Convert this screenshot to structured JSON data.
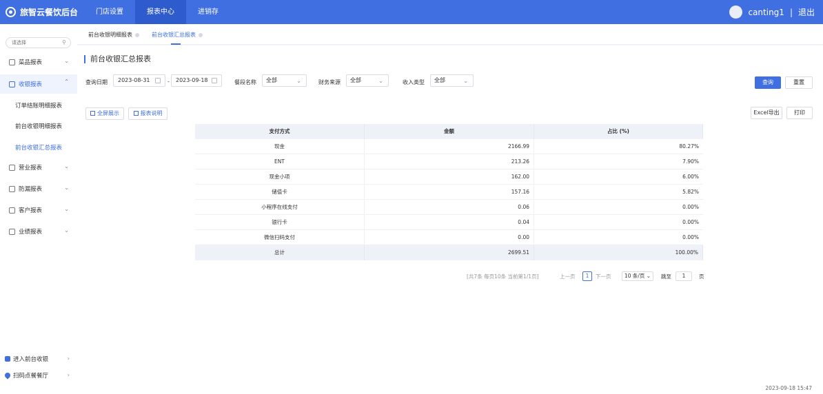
{
  "app": {
    "title": "旅智云餐饮后台"
  },
  "topnav": [
    {
      "label": "门店设置",
      "active": false
    },
    {
      "label": "报表中心",
      "active": true
    },
    {
      "label": "进销存",
      "active": false
    }
  ],
  "user": {
    "name": "canting1",
    "separator": "|",
    "logout": "退出"
  },
  "sidebar": {
    "search_placeholder": "请选择",
    "menu": {
      "dish_report": "菜品报表",
      "cashier_report": "收银报表",
      "sub_order_settle": "订单结账明细报表",
      "sub_front_detail": "前台收银明细报表",
      "sub_front_summary": "前台收银汇总报表",
      "business_report": "营业报表",
      "antileak_report": "防漏报表",
      "customer_report": "客户报表",
      "performance_report": "业绩报表"
    },
    "footer": {
      "enter_cashier": "进入前台收银",
      "scan_order": "扫码点餐餐厅"
    }
  },
  "tabs": [
    {
      "label": "前台收银明细报表",
      "active": false
    },
    {
      "label": "前台收银汇总报表",
      "active": true
    }
  ],
  "page": {
    "title": "前台收银汇总报表"
  },
  "filters": {
    "date_label": "查询日期",
    "date_start": "2023-08-31",
    "date_sep": "-",
    "date_end": "2023-09-18",
    "meal_label": "餐段名称",
    "meal_value": "全部",
    "finance_label": "财务来源",
    "finance_value": "全部",
    "income_label": "收入类型",
    "income_value": "全部"
  },
  "buttons": {
    "query": "查询",
    "reset": "重置",
    "fullscreen": "全屏展示",
    "report_desc": "报表说明",
    "excel_export": "Excel导出",
    "print": "打印"
  },
  "table": {
    "headers": {
      "method": "支付方式",
      "amount": "金额",
      "ratio": "占比 (%)"
    },
    "rows": [
      {
        "method": "现金",
        "amount": "2166.99",
        "ratio": "80.27%"
      },
      {
        "method": "ENT",
        "amount": "213.26",
        "ratio": "7.90%"
      },
      {
        "method": "现金小项",
        "amount": "162.00",
        "ratio": "6.00%"
      },
      {
        "method": "储值卡",
        "amount": "157.16",
        "ratio": "5.82%"
      },
      {
        "method": "小程序在线支付",
        "amount": "0.06",
        "ratio": "0.00%"
      },
      {
        "method": "银行卡",
        "amount": "0.04",
        "ratio": "0.00%"
      },
      {
        "method": "微信扫码支付",
        "amount": "0.00",
        "ratio": "0.00%"
      }
    ],
    "total": {
      "method": "总计",
      "amount": "2699.51",
      "ratio": "100.00%"
    }
  },
  "pagination": {
    "summary": "[共7条 每页10条 当前第1/1页]",
    "prev": "上一页",
    "current": "1",
    "next": "下一页",
    "page_size": "10 条/页",
    "jump_label": "跳至",
    "jump_value": "1",
    "page_unit": "页"
  },
  "timestamp": "2023-09-18 15:47"
}
